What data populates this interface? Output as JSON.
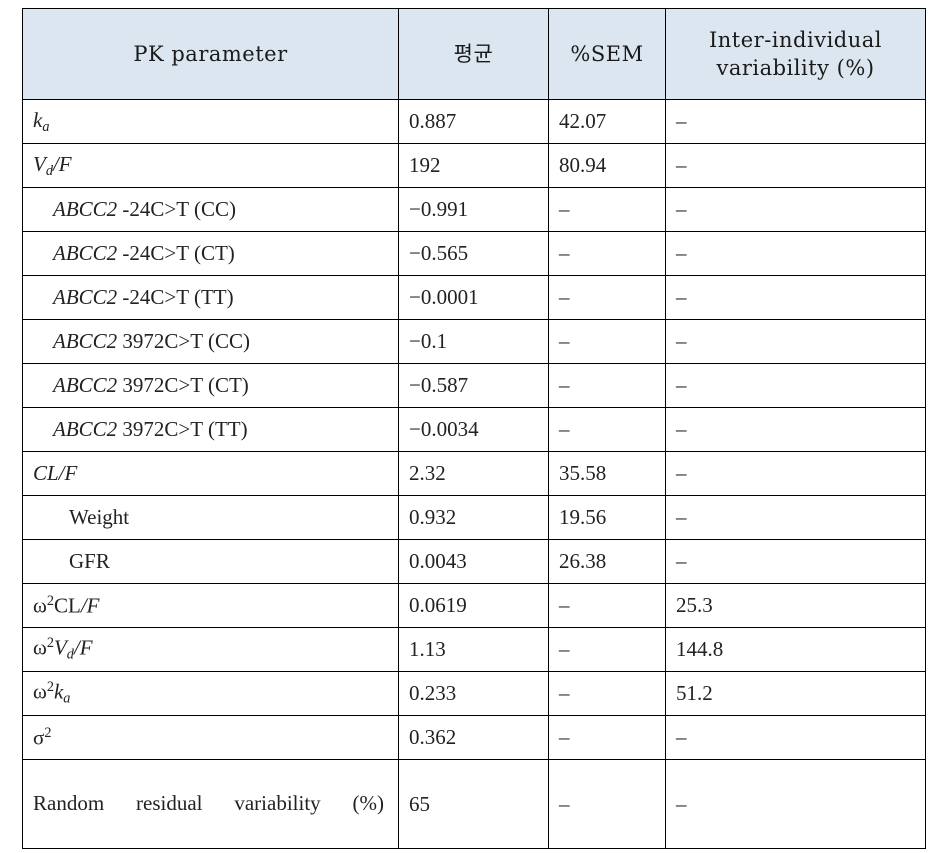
{
  "table": {
    "name": "pk-parameter-estimates-table",
    "columns": [
      {
        "key": "param",
        "label": "PK parameter"
      },
      {
        "key": "mean",
        "label": "평균"
      },
      {
        "key": "sem",
        "label": "%SEM"
      },
      {
        "key": "iiv",
        "label": "Inter-individual variability (%)"
      }
    ],
    "header_iiv_line1": "Inter-individual",
    "header_iiv_line2": "variability (%)",
    "rows": [
      {
        "param_plain": "ka",
        "mean": "0.887",
        "sem": "42.07",
        "iiv": "–",
        "indent": 0
      },
      {
        "param_plain": "Vd/F",
        "mean": "192",
        "sem": "80.94",
        "iiv": "–",
        "indent": 0
      },
      {
        "param_plain": "ABCC2 -24C>T (CC)",
        "mean": "−0.991",
        "sem": "–",
        "iiv": "–",
        "indent": 1
      },
      {
        "param_plain": "ABCC2 -24C>T (CT)",
        "mean": "−0.565",
        "sem": "–",
        "iiv": "–",
        "indent": 1
      },
      {
        "param_plain": "ABCC2 -24C>T (TT)",
        "mean": "−0.0001",
        "sem": "–",
        "iiv": "–",
        "indent": 1
      },
      {
        "param_plain": "ABCC2 3972C>T (CC)",
        "mean": "−0.1",
        "sem": "–",
        "iiv": "–",
        "indent": 1
      },
      {
        "param_plain": "ABCC2 3972C>T (CT)",
        "mean": "−0.587",
        "sem": "–",
        "iiv": "–",
        "indent": 1
      },
      {
        "param_plain": "ABCC2 3972C>T (TT)",
        "mean": "−0.0034",
        "sem": "–",
        "iiv": "–",
        "indent": 1
      },
      {
        "param_plain": "CL/F",
        "mean": "2.32",
        "sem": "35.58",
        "iiv": "–",
        "indent": 0
      },
      {
        "param_plain": "Weight",
        "mean": "0.932",
        "sem": "19.56",
        "iiv": "–",
        "indent": 2
      },
      {
        "param_plain": "GFR",
        "mean": "0.0043",
        "sem": "26.38",
        "iiv": "–",
        "indent": 2
      },
      {
        "param_plain": "ω2CL/F",
        "mean": "0.0619",
        "sem": "–",
        "iiv": "25.3",
        "indent": 0
      },
      {
        "param_plain": "ω2Vd/F",
        "mean": "1.13",
        "sem": "–",
        "iiv": "144.8",
        "indent": 0
      },
      {
        "param_plain": "ω2ka",
        "mean": "0.233",
        "sem": "–",
        "iiv": "51.2",
        "indent": 0
      },
      {
        "param_plain": "σ2",
        "mean": "0.362",
        "sem": "–",
        "iiv": "–",
        "indent": 0
      },
      {
        "param_plain": "Random residual variability (%)",
        "mean": "65",
        "sem": "–",
        "iiv": "–",
        "indent": 0
      }
    ],
    "parts": {
      "k": "k",
      "a": "a",
      "V": "V",
      "d": "d",
      "slashF": "/F",
      "abcc2": "ABCC2",
      "snp_24_cc": " -24C>T (CC)",
      "snp_24_ct": " -24C>T (CT)",
      "snp_24_tt": " -24C>T (TT)",
      "snp_3972_cc": " 3972C>T (CC)",
      "snp_3972_ct": " 3972C>T (CT)",
      "snp_3972_tt": " 3972C>T (TT)",
      "cl_f": "CL/F",
      "weight": "Weight",
      "gfr": "GFR",
      "omega": "ω",
      "sigma": "σ",
      "two": "2",
      "cl": "CL",
      "random_line1": "Random residual variability",
      "random_line2": "(%)"
    }
  },
  "colors": {
    "header_background": "#dce6f1",
    "border": "#000000",
    "text": "#222222",
    "page_background": "#ffffff"
  }
}
